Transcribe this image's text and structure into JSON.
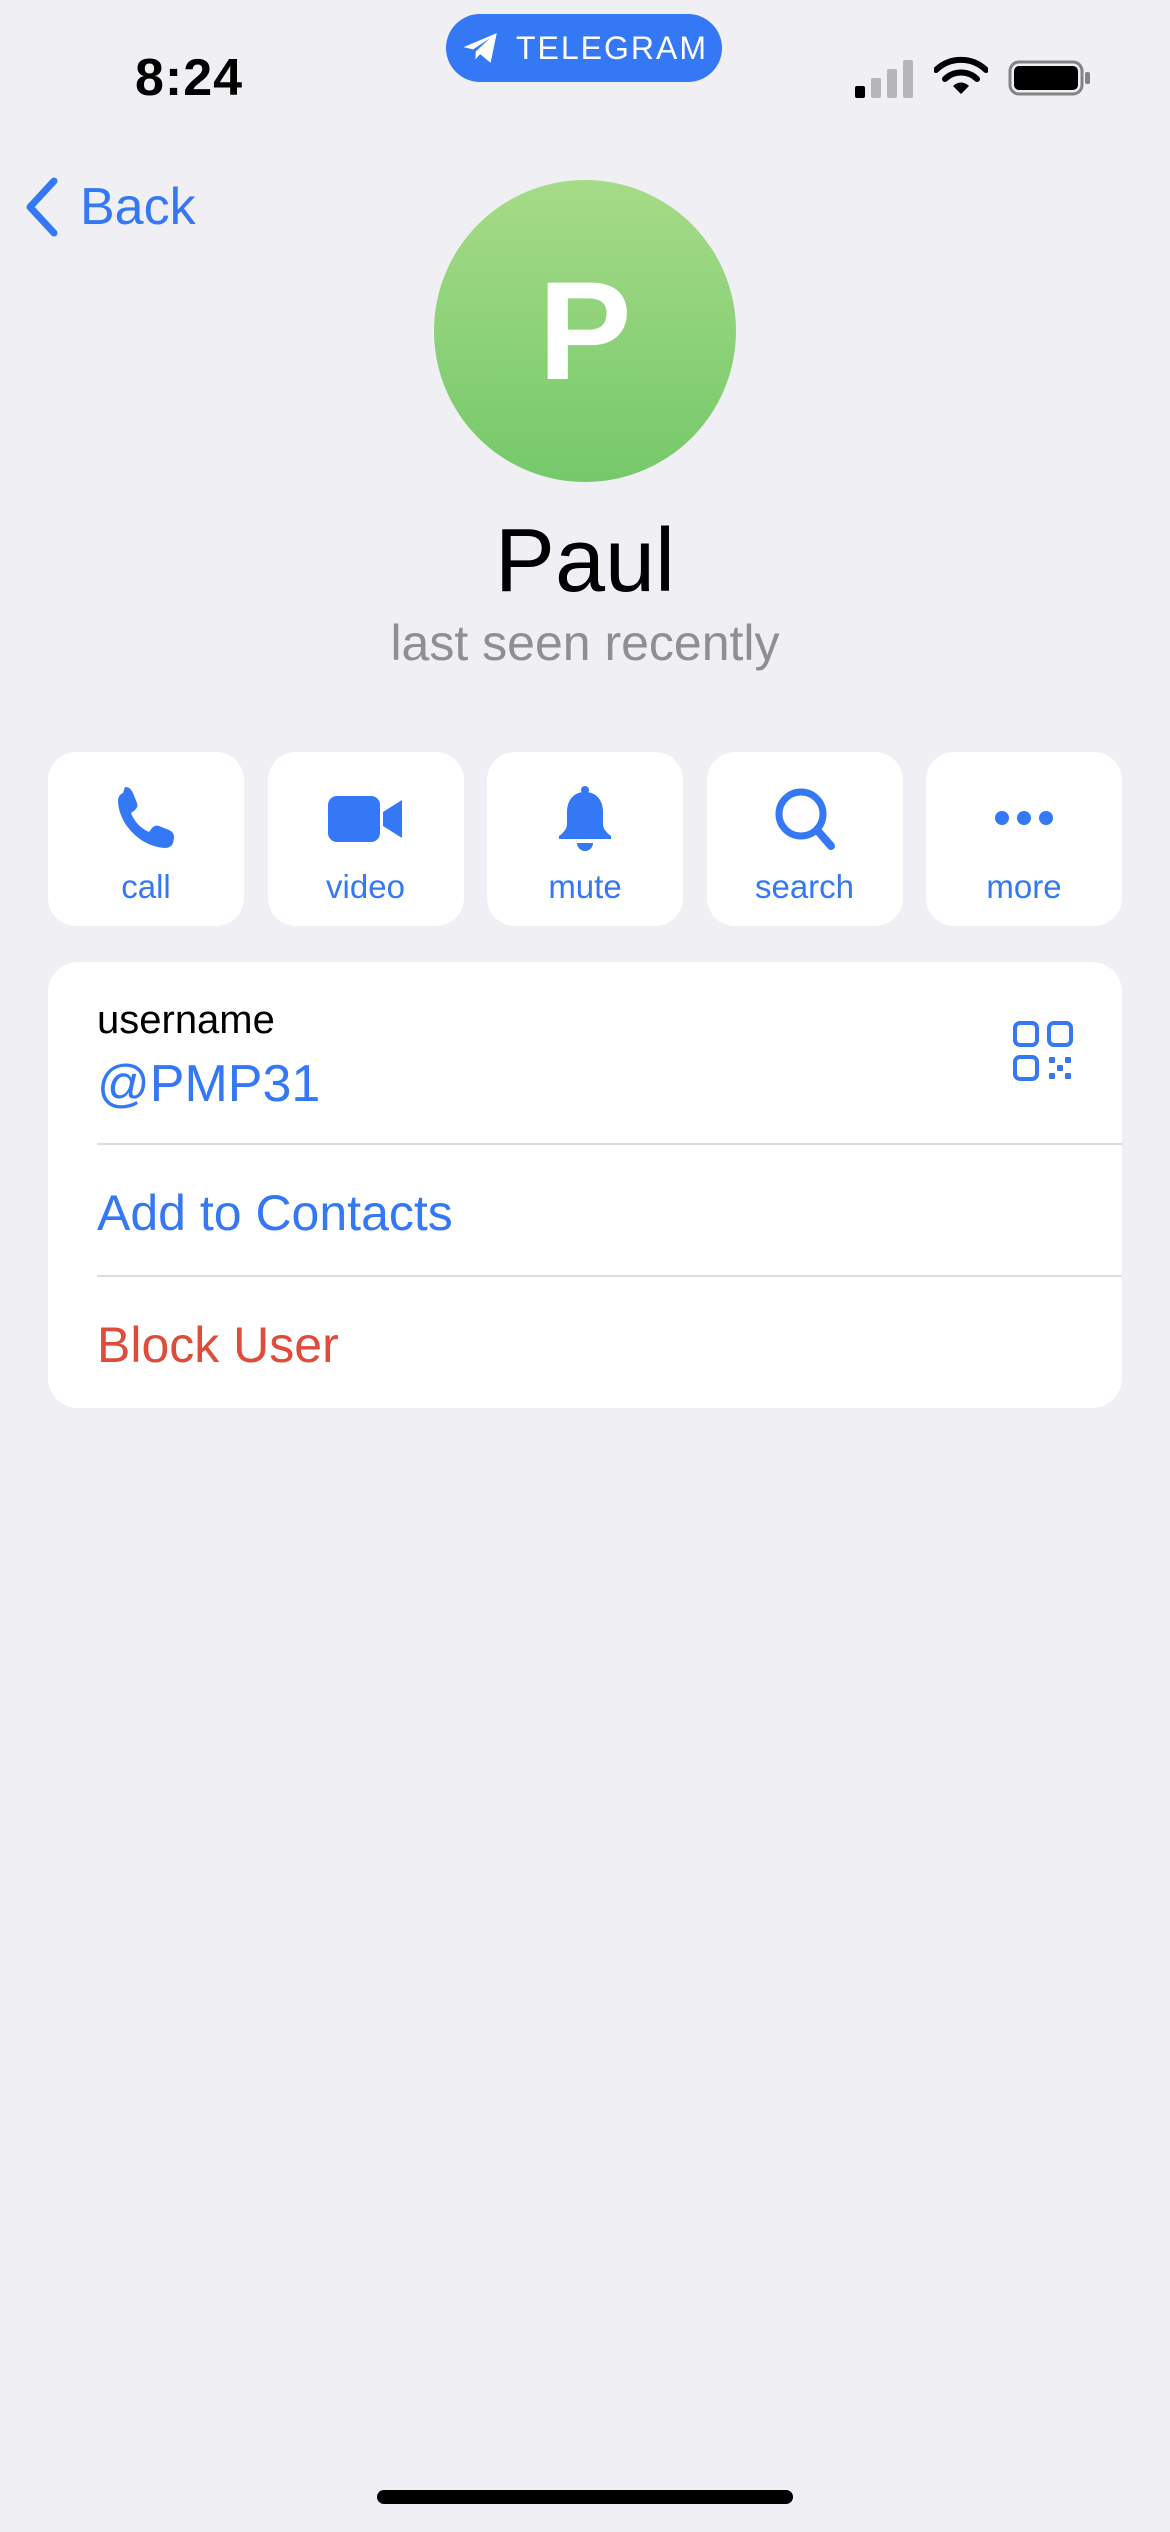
{
  "status_bar": {
    "time": "8:24",
    "app_pill": "TELEGRAM"
  },
  "nav": {
    "back_label": "Back"
  },
  "profile": {
    "avatar_initial": "P",
    "avatar_colors": [
      "#a6db87",
      "#75c96a"
    ],
    "name": "Paul",
    "status": "last seen recently"
  },
  "actions": [
    {
      "label": "call",
      "icon": "phone-icon"
    },
    {
      "label": "video",
      "icon": "video-camera-icon"
    },
    {
      "label": "mute",
      "icon": "bell-icon"
    },
    {
      "label": "search",
      "icon": "search-icon"
    },
    {
      "label": "more",
      "icon": "ellipsis-icon"
    }
  ],
  "info": {
    "username_label": "username",
    "username_value": "@PMP31",
    "add_contacts": "Add to Contacts",
    "block_user": "Block User"
  },
  "colors": {
    "accent": "#3478f6",
    "destructive": "#df4c3b",
    "background": "#efeff4",
    "secondary_text": "#8e8e93"
  }
}
